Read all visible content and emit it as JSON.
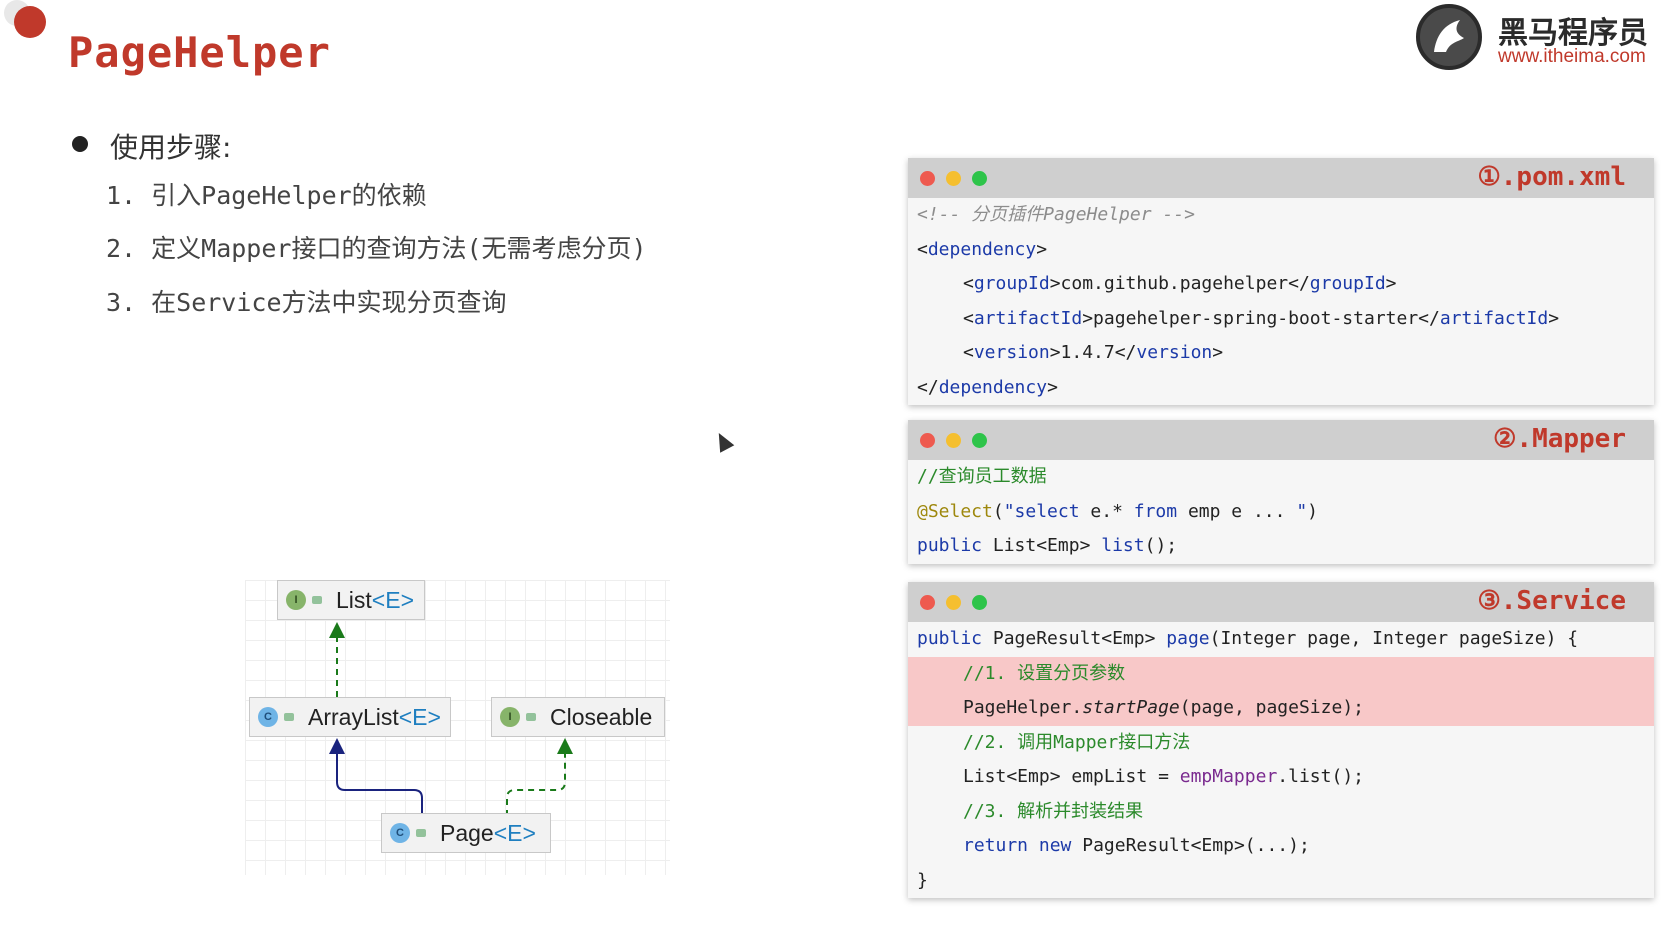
{
  "slide": {
    "title": "PageHelper",
    "logo": {
      "brand": "黑马程序员",
      "url": "www.itheima.com"
    },
    "steps_heading": "使用步骤:",
    "steps": [
      "1. 引入PageHelper的依赖",
      "2. 定义Mapper接口的查询方法(无需考虑分页)",
      "3. 在Service方法中实现分页查询"
    ]
  },
  "diagram": {
    "nodes": {
      "list": {
        "badge": "I",
        "name": "List",
        "generic": "<E>"
      },
      "arraylist": {
        "badge": "C",
        "name": "ArrayList",
        "generic": "<E>"
      },
      "closeable": {
        "badge": "I",
        "name": "Closeable",
        "generic": ""
      },
      "page": {
        "badge": "C",
        "name": "Page",
        "generic": "<E>"
      }
    },
    "colors": {
      "implements_arrow": "#1a7a1a",
      "extends_arrow": "#1a237e"
    }
  },
  "windows": {
    "pom": {
      "title": "①.pom.xml",
      "lines": {
        "l1": "<!-- 分页插件PageHelper -->",
        "l2_open": "<",
        "l2_tag": "dependency",
        "l2_close": ">",
        "l3_a": "<",
        "l3_tag": "groupId",
        "l3_b": ">com.github.pagehelper</",
        "l3_tag2": "groupId",
        "l3_c": ">",
        "l4_a": "<",
        "l4_tag": "artifactId",
        "l4_b": ">pagehelper-spring-boot-starter</",
        "l4_tag2": "artifactId",
        "l4_c": ">",
        "l5_a": "<",
        "l5_tag": "version",
        "l5_b": ">1.4.7</",
        "l5_tag2": "version",
        "l5_c": ">",
        "l6_open": "</",
        "l6_tag": "dependency",
        "l6_close": ">"
      }
    },
    "mapper": {
      "title": "②.Mapper",
      "lines": {
        "l1": "//查询员工数据",
        "l2_ann": "@Select",
        "l2_a": "(",
        "l2_str1": "\"select",
        "l2_b": " e.* ",
        "l2_kw": "from",
        "l2_c": " emp e ... ",
        "l2_str2": "\"",
        "l2_d": ")",
        "l3_kw": "public",
        "l3_a": " List<Emp> ",
        "l3_m": "list",
        "l3_b": "();"
      }
    },
    "service": {
      "title": "③.Service",
      "lines": {
        "l1_kw": "public",
        "l1_a": " PageResult<Emp> ",
        "l1_m": "page",
        "l1_b": "(Integer page, Integer pageSize) {",
        "l2": "//1. 设置分页参数",
        "l3_a": "PageHelper.",
        "l3_m": "startPage",
        "l3_b": "(page, pageSize);",
        "l4": "//2. 调用Mapper接口方法",
        "l5_a": "List<Emp> empList = ",
        "l5_f": "empMapper",
        "l5_b": ".list();",
        "l6": "//3. 解析并封装结果",
        "l7_kw1": "return",
        "l7_sp": " ",
        "l7_kw2": "new",
        "l7_a": " PageResult<Emp>(...);",
        "l8": "}"
      }
    }
  }
}
